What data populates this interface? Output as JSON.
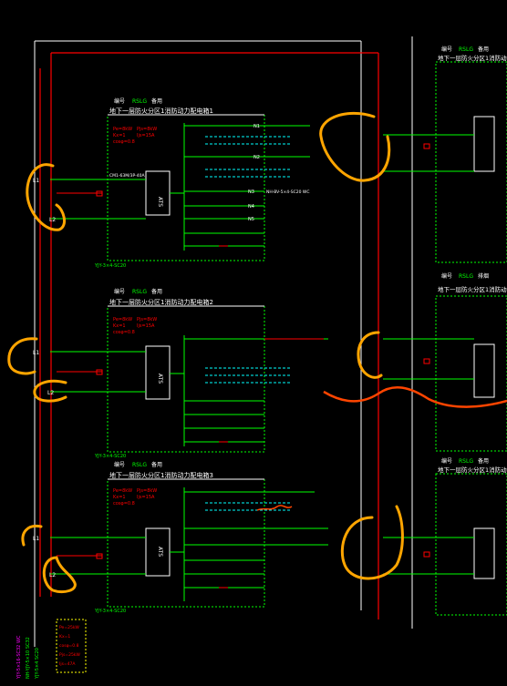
{
  "panels": [
    {
      "id": "p1",
      "title": "地下一层防火分区1消防动力配电箱1",
      "code_label": "编号",
      "code_value": "RSLG",
      "note": "备用",
      "params": [
        "Pe=8kW",
        "Kx=1",
        "cosφ=0.8",
        "Pjs=8kW",
        "Ijs=15A"
      ]
    },
    {
      "id": "p2",
      "title": "地下一层防火分区1消防动力配电箱2",
      "code_label": "编号",
      "code_value": "RSLG",
      "note": "备用",
      "params": [
        "Pe=8kW",
        "Kx=1",
        "cosφ=0.8",
        "Pjs=8kW",
        "Ijs=15A"
      ]
    },
    {
      "id": "p3",
      "title": "地下一层防火分区1消防动力配电箱3",
      "code_label": "编号",
      "code_value": "RSLG",
      "note": "备用",
      "params": [
        "Pe=8kW",
        "Kx=1",
        "cosφ=0.8",
        "Pjs=8kW",
        "Ijs=15A"
      ]
    }
  ],
  "right_panels": [
    {
      "title": "地下一层防火分区1消防动力配电箱",
      "code_label": "编号",
      "code_value": "RSLG",
      "note": "备用"
    },
    {
      "title": "地下一层防火分区1消防动力配电箱",
      "code_label": "编号",
      "code_value": "RSLG",
      "note": "排烟"
    },
    {
      "title": "地下一层防火分区1消防动力配电箱",
      "code_label": "编号",
      "code_value": "RSLG",
      "note": "备用"
    }
  ],
  "labels": {
    "l1": "L1",
    "l2": "L2",
    "ats": "ATS",
    "cable_bottom": "YJY-3×4-SC20",
    "cable_left": "NH-YJY-5×10",
    "breaker": "CM1-63M/3P-40A",
    "feeder_out": "NH-BV-5×4-SC20 WC"
  },
  "circuits": [
    "N1",
    "N2",
    "N3",
    "N4",
    "N5",
    "N6"
  ],
  "legend_box": [
    "Pe=25kW",
    "Kx=1",
    "cosφ=0.8",
    "Pjs=25kW",
    "Ijs=47A"
  ],
  "left_vertical_text": [
    "YJY-5×16-SC32 WC",
    "NH-YJY-5×10 SC32",
    "YJY-5×4 SC20"
  ],
  "colors": {
    "background": "#000000",
    "wire": "#00ff00",
    "red": "#ff0000",
    "white": "#ffffff",
    "cyan": "#00ffff",
    "yellow": "#ffff00",
    "magenta": "#ff00ff",
    "markup_orange": "#ffa500",
    "markup_red": "#ff4500"
  }
}
